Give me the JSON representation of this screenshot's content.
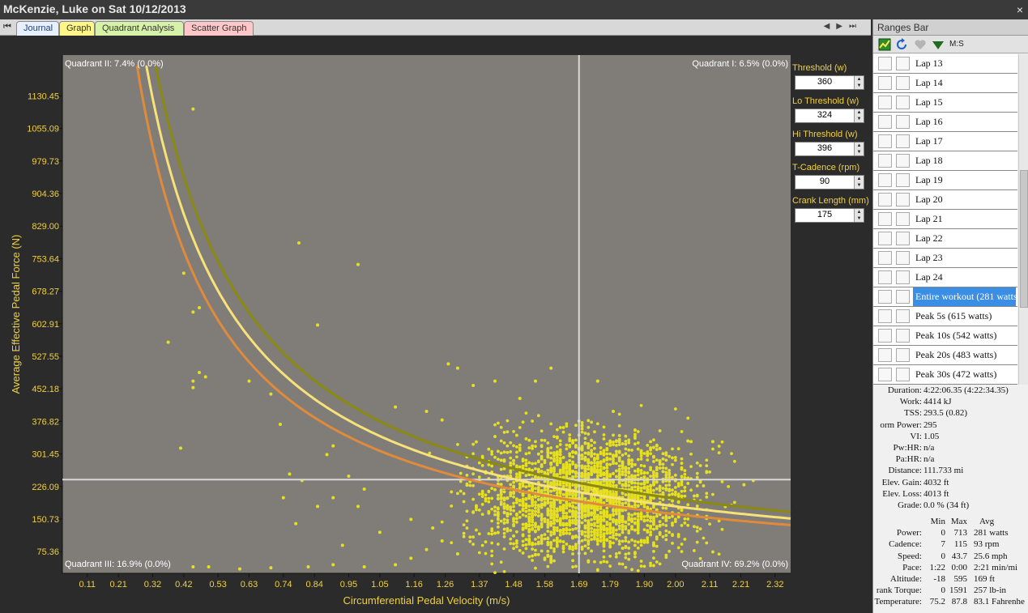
{
  "window": {
    "title": "McKenzie, Luke on Sat 10/12/2013",
    "close": "×"
  },
  "tabs": [
    {
      "label": "Journal"
    },
    {
      "label": "Graph"
    },
    {
      "label": "Quadrant Analysis"
    },
    {
      "label": "Scatter Graph"
    }
  ],
  "params": {
    "threshold": {
      "label": "Threshold (w)",
      "value": "360"
    },
    "lo_threshold": {
      "label": "Lo Threshold (w)",
      "value": "324"
    },
    "hi_threshold": {
      "label": "Hi Threshold (w)",
      "value": "396"
    },
    "t_cadence": {
      "label": "T-Cadence (rpm)",
      "value": "90"
    },
    "crank_length": {
      "label": "Crank Length (mm)",
      "value": "175"
    }
  },
  "ranges_bar": {
    "title": "Ranges Bar",
    "toolbar_ms": "M:S",
    "items": [
      "Lap 13",
      "Lap 14",
      "Lap 15",
      "Lap 16",
      "Lap 17",
      "Lap 18",
      "Lap 19",
      "Lap 20",
      "Lap 21",
      "Lap 22",
      "Lap 23",
      "Lap 24",
      "Entire workout (281 watts)",
      "Peak 5s (615 watts)",
      "Peak 10s (542 watts)",
      "Peak 20s (483 watts)",
      "Peak 30s (472 watts)"
    ],
    "selected_index": 12
  },
  "stats": {
    "duration": {
      "key": "Duration:",
      "value": "4:22:06.35 (4:22:34.35)"
    },
    "work": {
      "key": "Work:",
      "value": "4414 kJ"
    },
    "tss": {
      "key": "TSS:",
      "value": "293.5 (0.82)"
    },
    "norm_power": {
      "key": "orm Power:",
      "value": "295"
    },
    "vi": {
      "key": "VI:",
      "value": "1.05"
    },
    "pwhr": {
      "key": "Pw:HR:",
      "value": "n/a"
    },
    "pahr": {
      "key": "Pa:HR:",
      "value": "n/a"
    },
    "distance": {
      "key": "Distance:",
      "value": "111.733 mi"
    },
    "elev_gain": {
      "key": "Elev. Gain:",
      "value": "4032 ft"
    },
    "elev_loss": {
      "key": "Elev. Loss:",
      "value": "4013 ft"
    },
    "grade": {
      "key": "Grade:",
      "value": "0.0 %  (34 ft)"
    }
  },
  "stats_table": {
    "headers": [
      "Min",
      "Max",
      "Avg"
    ],
    "rows": [
      {
        "key": "Power:",
        "min": "0",
        "max": "713",
        "avg": "281 watts"
      },
      {
        "key": "Cadence:",
        "min": "7",
        "max": "115",
        "avg": "93 rpm"
      },
      {
        "key": "Speed:",
        "min": "0",
        "max": "43.7",
        "avg": "25.6 mph"
      },
      {
        "key": "Pace:",
        "min": "1:22",
        "max": "0:00",
        "avg": "2:21 min/mi"
      },
      {
        "key": "Altitude:",
        "min": "-18",
        "max": "595",
        "avg": "169 ft"
      },
      {
        "key": "rank Torque:",
        "min": "0",
        "max": "1591",
        "avg": "257 lb-in"
      },
      {
        "key": "Temperature:",
        "min": "75.2",
        "max": "87.8",
        "avg": "83.1 Fahrenhe"
      }
    ]
  },
  "colors": {
    "plot_bg": "#807c78",
    "points": "#e6e020",
    "curve_threshold": "#f7e27a",
    "curve_hi": "#8a8a10",
    "curve_lo": "#e08a3c",
    "tick_text": "#f0d040",
    "crosshair": "#d8d8d8"
  },
  "chart_data": {
    "type": "scatter",
    "xlabel": "Circumferential Pedal Velocity (m/s)",
    "ylabel": "Average Effective Pedal Force (N)",
    "xlim": [
      0.03,
      2.37
    ],
    "ylim": [
      25,
      1225
    ],
    "x_ticks": [
      "0.11",
      "0.21",
      "0.32",
      "0.42",
      "0.53",
      "0.63",
      "0.74",
      "0.84",
      "0.95",
      "1.05",
      "1.16",
      "1.26",
      "1.37",
      "1.48",
      "1.58",
      "1.69",
      "1.79",
      "1.90",
      "2.00",
      "2.11",
      "2.21",
      "2.32"
    ],
    "y_ticks": [
      "75.36",
      "150.73",
      "226.09",
      "301.45",
      "376.82",
      "452.18",
      "527.55",
      "602.91",
      "678.27",
      "753.64",
      "829.00",
      "904.36",
      "979.73",
      "1055.09",
      "1130.45"
    ],
    "crosshair": {
      "x": 1.69,
      "y": 242
    },
    "quadrants": {
      "q1": "Quadrant I: 6.5% (0.0%)",
      "q2": "Quadrant II: 7.4% (0.0%)",
      "q3": "Quadrant III: 16.9% (0.0%)",
      "q4": "Quadrant IV: 69.2% (0.0%)"
    },
    "curves": [
      {
        "power_w": 396
      },
      {
        "power_w": 360
      },
      {
        "power_w": 324
      }
    ],
    "cluster": {
      "x_center": 1.72,
      "y_center": 205,
      "x_spread": 0.17,
      "y_spread": 70,
      "count": 2600
    },
    "outliers": [
      [
        0.45,
        1100
      ],
      [
        0.42,
        720
      ],
      [
        0.37,
        560
      ],
      [
        0.45,
        630
      ],
      [
        0.47,
        640
      ],
      [
        0.45,
        470
      ],
      [
        0.45,
        455
      ],
      [
        0.47,
        490
      ],
      [
        0.49,
        480
      ],
      [
        0.79,
        790
      ],
      [
        0.98,
        740
      ],
      [
        0.85,
        600
      ],
      [
        0.63,
        470
      ],
      [
        0.7,
        440
      ],
      [
        0.73,
        370
      ],
      [
        0.41,
        315
      ],
      [
        0.76,
        255
      ],
      [
        0.74,
        200
      ],
      [
        0.8,
        240
      ],
      [
        0.85,
        180
      ],
      [
        0.88,
        300
      ],
      [
        0.9,
        320
      ],
      [
        0.95,
        250
      ],
      [
        1.0,
        220
      ],
      [
        1.1,
        410
      ],
      [
        1.2,
        400
      ],
      [
        1.25,
        380
      ],
      [
        1.27,
        510
      ],
      [
        1.3,
        500
      ],
      [
        1.35,
        460
      ],
      [
        1.42,
        470
      ],
      [
        1.5,
        430
      ],
      [
        1.55,
        470
      ],
      [
        1.6,
        500
      ],
      [
        1.75,
        470
      ],
      [
        1.8,
        400
      ],
      [
        2.05,
        330
      ],
      [
        2.12,
        330
      ],
      [
        2.22,
        230
      ],
      [
        2.25,
        240
      ],
      [
        0.45,
        40
      ],
      [
        0.5,
        40
      ],
      [
        0.6,
        35
      ],
      [
        0.7,
        38
      ],
      [
        0.82,
        40
      ],
      [
        0.9,
        45
      ],
      [
        1.0,
        40
      ],
      [
        1.1,
        45
      ],
      [
        1.15,
        60
      ],
      [
        1.2,
        80
      ],
      [
        1.25,
        100
      ],
      [
        1.3,
        70
      ],
      [
        0.93,
        90
      ],
      [
        1.05,
        120
      ],
      [
        1.15,
        150
      ],
      [
        1.22,
        130
      ],
      [
        0.78,
        140
      ],
      [
        0.9,
        200
      ],
      [
        0.98,
        180
      ]
    ]
  }
}
